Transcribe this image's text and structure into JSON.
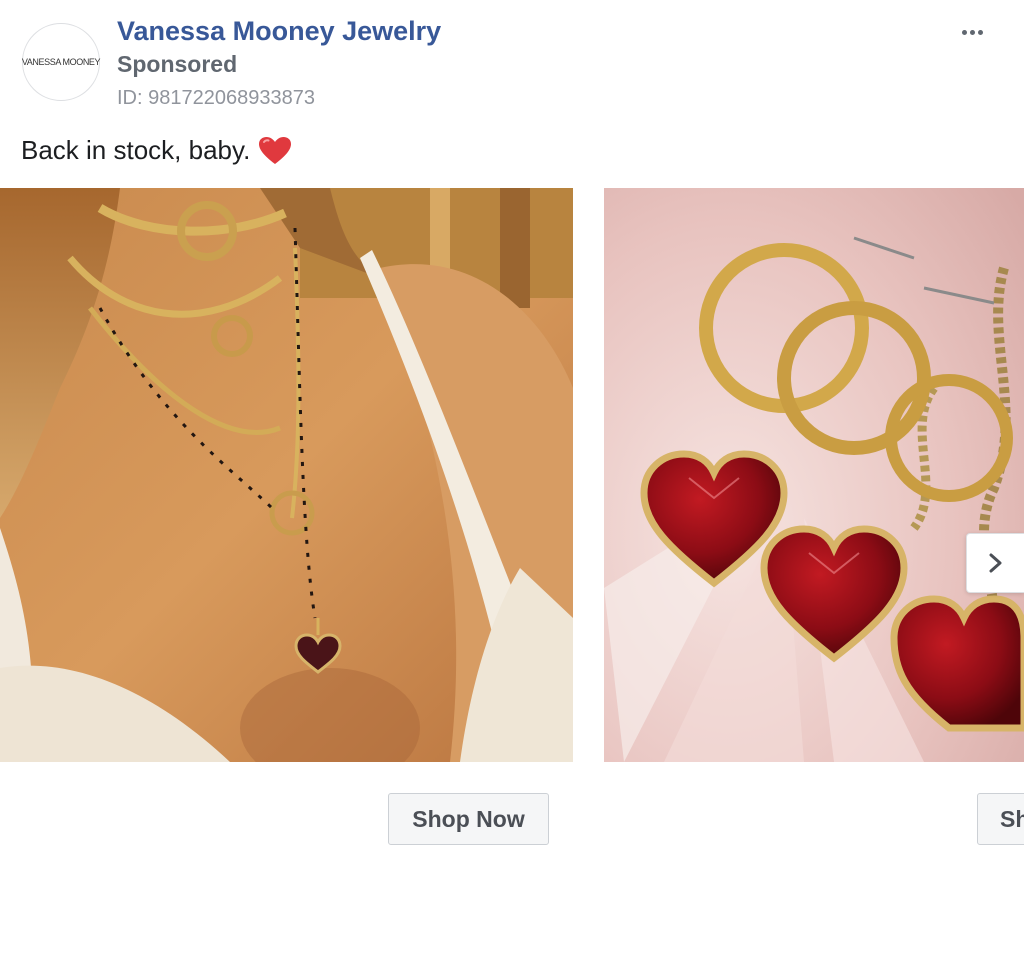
{
  "header": {
    "avatar_text": "VANESSA MOONEY",
    "page_name": "Vanessa Mooney Jewelry",
    "sponsored": "Sponsored",
    "ad_id": "ID: 981722068933873"
  },
  "post": {
    "text": "Back in stock, baby.",
    "emoji_icon": "red-heart-icon"
  },
  "carousel": {
    "cards": [
      {
        "image_icon": "necklace-photo",
        "cta": "Shop Now"
      },
      {
        "image_icon": "heart-earrings-photo",
        "cta": "Shop Now"
      }
    ],
    "next_icon": "chevron-right-icon"
  },
  "colors": {
    "page_name": "#385898",
    "secondary_text": "#606770",
    "id_text": "#90949c",
    "button_bg": "#f5f6f7",
    "button_border": "#ccd0d5"
  }
}
